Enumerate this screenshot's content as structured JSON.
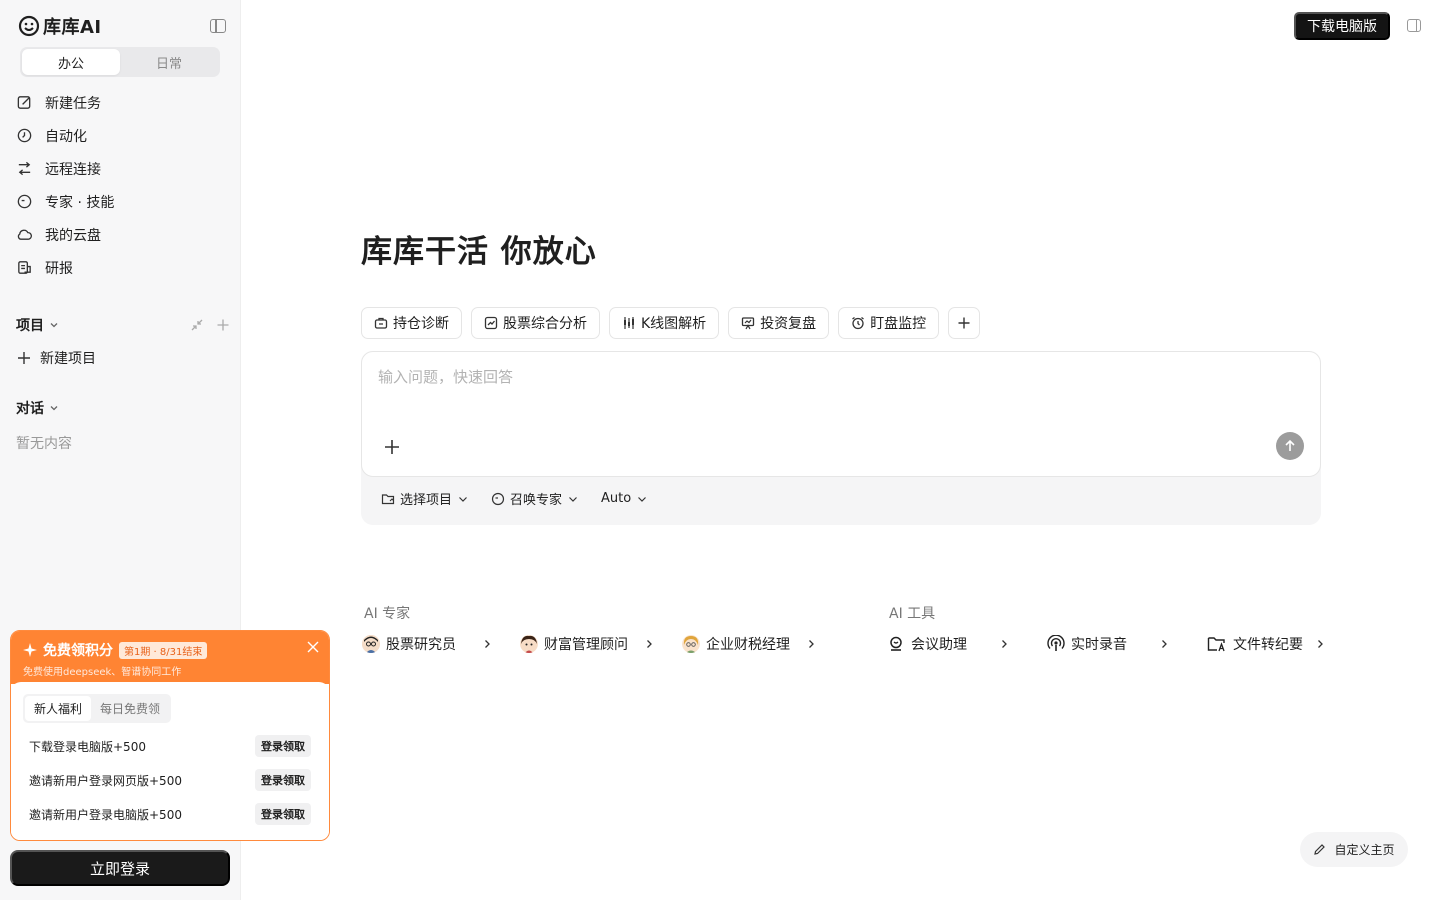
{
  "brand": {
    "name": "库库AI"
  },
  "mode_tabs": [
    {
      "label": "办公",
      "active": true
    },
    {
      "label": "日常",
      "active": false
    }
  ],
  "nav": [
    {
      "label": "新建任务",
      "icon": "edit-icon"
    },
    {
      "label": "自动化",
      "icon": "clock-icon"
    },
    {
      "label": "远程连接",
      "icon": "swap-icon"
    },
    {
      "label": "专家 · 技能",
      "icon": "expert-icon"
    },
    {
      "label": "我的云盘",
      "icon": "cloud-icon"
    },
    {
      "label": "研报",
      "icon": "report-icon"
    }
  ],
  "projects": {
    "title": "项目",
    "new_label": "新建项目"
  },
  "conversations": {
    "title": "对话",
    "empty": "暂无内容"
  },
  "promo": {
    "title": "免费领积分",
    "badge": "第1期 · 8/31结束",
    "subtitle": "免费使用deepseek、智谱协同工作",
    "tabs": [
      {
        "label": "新人福利",
        "active": true
      },
      {
        "label": "每日免费领",
        "active": false
      }
    ],
    "rewards": [
      {
        "label": "下载登录电脑版+500",
        "button": "登录领取"
      },
      {
        "label": "邀请新用户登录网页版+500",
        "button": "登录领取"
      },
      {
        "label": "邀请新用户登录电脑版+500",
        "button": "登录领取"
      }
    ]
  },
  "login_button": "立即登录",
  "header": {
    "download_label": "下载电脑版"
  },
  "hero": {
    "title": "库库干活 你放心"
  },
  "chips": [
    {
      "label": "持仓诊断",
      "icon": "briefcase-icon"
    },
    {
      "label": "股票综合分析",
      "icon": "chart-icon"
    },
    {
      "label": "K线图解析",
      "icon": "candlestick-icon"
    },
    {
      "label": "投资复盘",
      "icon": "presentation-icon"
    },
    {
      "label": "盯盘监控",
      "icon": "alarm-icon"
    }
  ],
  "composer": {
    "placeholder": "输入问题，快速回答",
    "tools": [
      {
        "label": "选择项目",
        "icon": "folder-icon"
      },
      {
        "label": "召唤专家",
        "icon": "expert-icon"
      },
      {
        "label": "Auto",
        "icon": ""
      }
    ]
  },
  "ai_experts": {
    "title": "AI 专家",
    "items": [
      {
        "label": "股票研究员"
      },
      {
        "label": "财富管理顾问"
      },
      {
        "label": "企业财税经理"
      }
    ]
  },
  "ai_tools": {
    "title": "AI 工具",
    "items": [
      {
        "label": "会议助理",
        "icon": "meeting-icon"
      },
      {
        "label": "实时录音",
        "icon": "podcast-icon"
      },
      {
        "label": "文件转纪要",
        "icon": "folder-text-icon"
      }
    ]
  },
  "customize_label": "自定义主页",
  "colors": {
    "accent_orange": "#ff8433",
    "dark": "#141414"
  }
}
